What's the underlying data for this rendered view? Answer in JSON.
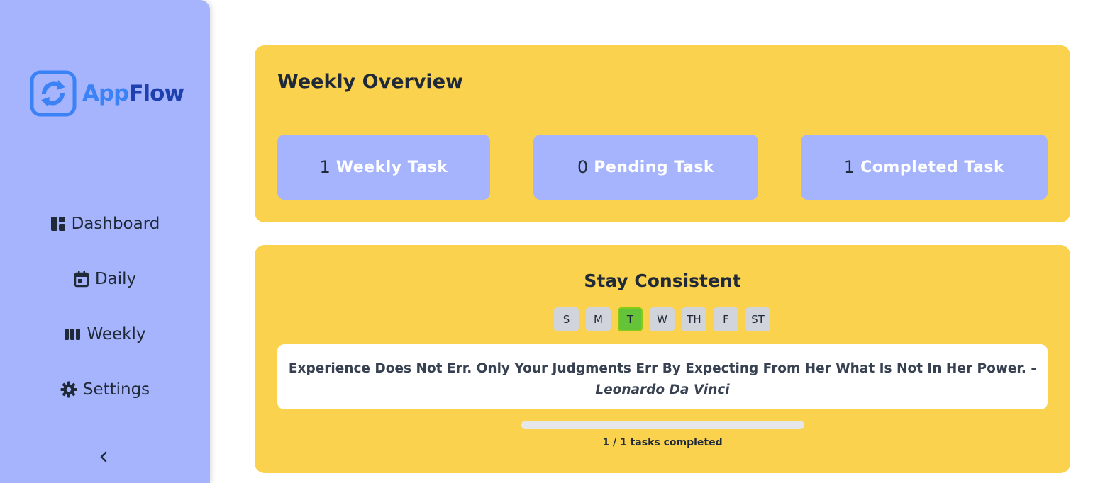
{
  "app": {
    "name_part1": "App",
    "name_part2": "Flow"
  },
  "sidebar": {
    "items": [
      {
        "label": "Dashboard",
        "icon": "dashboard-icon"
      },
      {
        "label": "Daily",
        "icon": "calendar-icon"
      },
      {
        "label": "Weekly",
        "icon": "columns-icon"
      },
      {
        "label": "Settings",
        "icon": "gear-icon"
      }
    ],
    "collapse_icon": "chevron-left-icon"
  },
  "overview": {
    "title": "Weekly Overview",
    "stats": [
      {
        "value": "1",
        "label": "Weekly Task"
      },
      {
        "value": "0",
        "label": "Pending Task"
      },
      {
        "value": "1",
        "label": "Completed Task"
      }
    ]
  },
  "consistency": {
    "title": "Stay Consistent",
    "days": [
      "S",
      "M",
      "T",
      "W",
      "TH",
      "F",
      "ST"
    ],
    "active_day": "T",
    "quote": "Experience Does Not Err. Only Your Judgments Err By Expecting From Her What Is Not In Her Power. -",
    "author": "Leonardo Da Vinci",
    "progress_fraction": 1.0,
    "progress_text": "1 / 1 tasks completed"
  },
  "colors": {
    "sidebar": "#a5b4fc",
    "card": "#fad24e",
    "stat_box": "#a5b4fc",
    "active_day": "#65c33a",
    "logo_primary": "#3b82f6",
    "logo_dark": "#1e40af"
  }
}
